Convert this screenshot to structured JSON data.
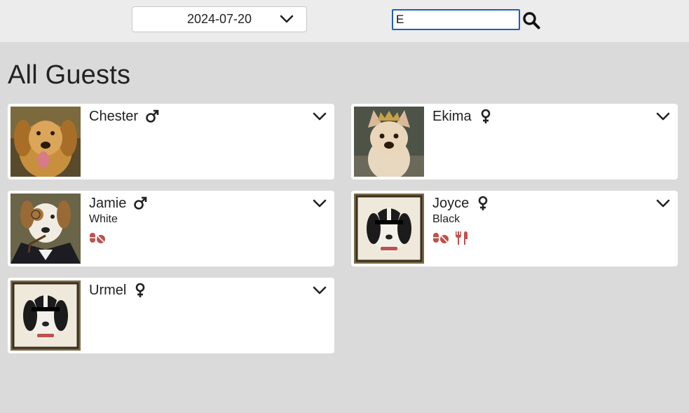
{
  "header": {
    "date_value": "2024-07-20",
    "search_value": "E",
    "search_placeholder": ""
  },
  "page_title": "All Guests",
  "colors": {
    "accent_red": "#c0504d",
    "input_focus_border": "#1f5fb5",
    "background": "#dadada",
    "topbar": "#ececec"
  },
  "guests": [
    {
      "name": "Chester",
      "gender": "male-icon",
      "color": "",
      "flags": []
    },
    {
      "name": "Ekima",
      "gender": "female-icon",
      "color": "",
      "flags": []
    },
    {
      "name": "Jamie",
      "gender": "male-icon",
      "color": "White",
      "flags": [
        "medication-icon"
      ]
    },
    {
      "name": "Joyce",
      "gender": "female-icon",
      "color": "Black",
      "flags": [
        "medication-icon",
        "food-icon"
      ]
    },
    {
      "name": "Urmel",
      "gender": "female-icon",
      "color": "",
      "flags": []
    }
  ]
}
